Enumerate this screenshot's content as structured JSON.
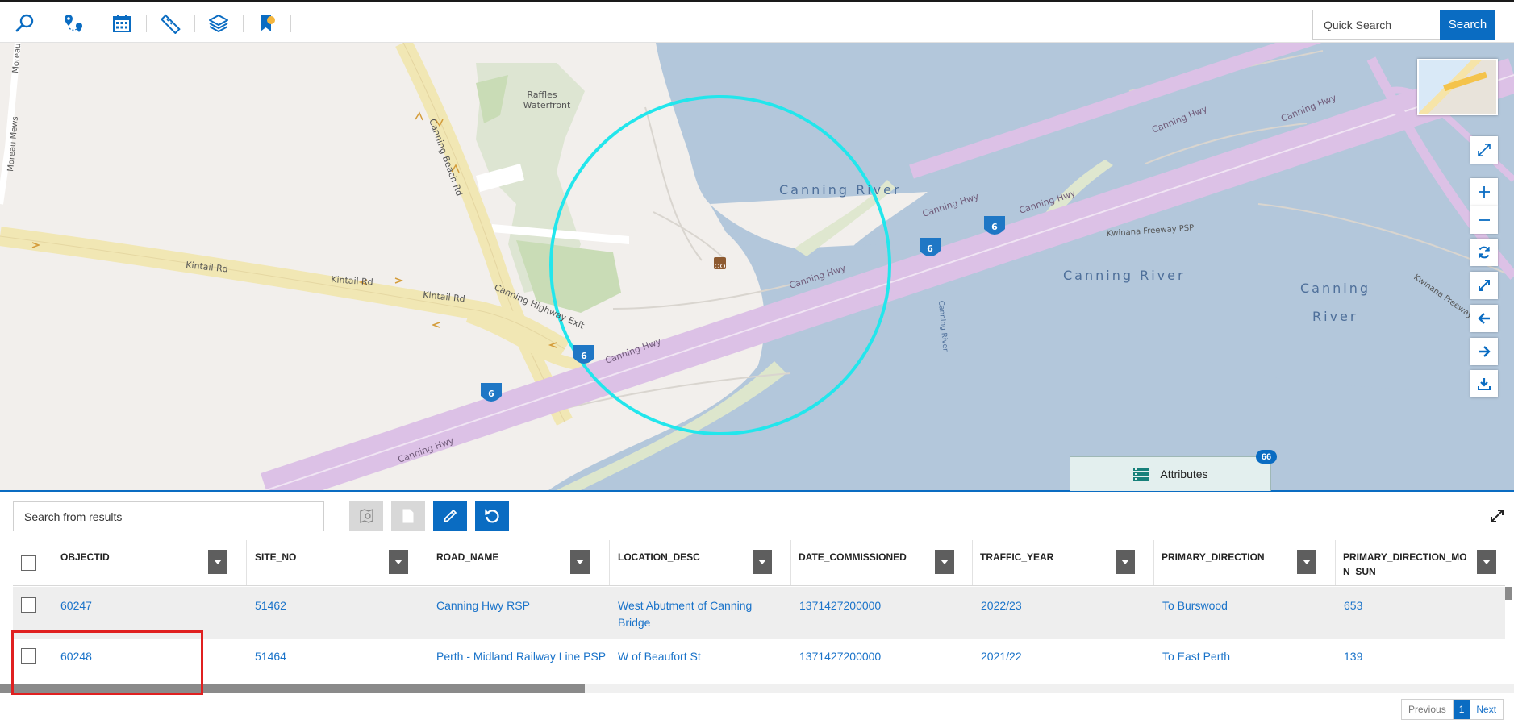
{
  "toolbar": {
    "tools": [
      {
        "name": "search-icon"
      },
      {
        "name": "locations-icon"
      },
      {
        "name": "calendar-icon"
      },
      {
        "name": "measure-icon"
      },
      {
        "name": "layers-icon"
      },
      {
        "name": "bookmark-icon"
      }
    ],
    "quick_search_placeholder": "Quick Search",
    "search_label": "Search"
  },
  "map": {
    "labels": {
      "raffles_1": "Raffles",
      "raffles_2": "Waterfront",
      "moreau_mews": "Moreau Mews",
      "moreau": "Moreau",
      "canning_beach_rd": "Canning Beach Rd",
      "kintail_rd_1": "Kintail Rd",
      "kintail_rd_2": "Kintail Rd",
      "kintail_rd_3": "Kintail Rd",
      "canning_highway_exit": "Canning Highway Exit",
      "canning_hwy_1": "Canning Hwy",
      "canning_hwy_2": "Canning Hwy",
      "canning_hwy_3": "Canning Hwy",
      "canning_hwy_4": "Canning Hwy",
      "canning_hwy_5": "Canning Hwy",
      "canning_hwy_6": "Canning Hwy",
      "canning_hwy_7": "Canning Hwy",
      "canning_river_1": "Canning River",
      "canning_river_2": "Canning River",
      "canning_river_3a": "Canning",
      "canning_river_3b": "River",
      "canning_river_small": "Canning River",
      "kwinana_psp": "Kwinana Freeway PSP",
      "kwinana_f": "Kwinana Freeway F",
      "route_shield": "6"
    },
    "controls": [
      "expand-icon",
      "zoom-in-icon",
      "zoom-out-icon",
      "refresh-icon",
      "full-extent-icon",
      "previous-extent-icon",
      "next-extent-icon",
      "download-icon"
    ]
  },
  "attributes_tab": {
    "label": "Attributes",
    "count": "66"
  },
  "panel": {
    "search_placeholder": "Search from results",
    "actions": [
      "zoom-to-selection-icon",
      "export-icon",
      "edit-icon",
      "reset-icon"
    ]
  },
  "grid": {
    "columns": [
      {
        "label": "OBJECTID"
      },
      {
        "label": "SITE_NO"
      },
      {
        "label": "ROAD_NAME"
      },
      {
        "label": "LOCATION_DESC"
      },
      {
        "label": "DATE_COMMISSIONED"
      },
      {
        "label": "TRAFFIC_YEAR"
      },
      {
        "label": "PRIMARY_DIRECTION"
      },
      {
        "label": "PRIMARY_DIRECTION_MO N_SUN"
      }
    ],
    "rows": [
      {
        "cells": [
          "60247",
          "51462",
          "Canning Hwy RSP",
          "West Abutment of Canning Bridge",
          "1371427200000",
          "2022/23",
          "To Burswood",
          "653"
        ]
      },
      {
        "cells": [
          "60248",
          "51464",
          "Perth - Midland Railway Line PSP",
          "W of Beaufort St",
          "1371427200000",
          "2021/22",
          "To East Perth",
          "139"
        ]
      }
    ]
  },
  "pager": {
    "previous": "Previous",
    "current": "1",
    "next": "Next"
  }
}
